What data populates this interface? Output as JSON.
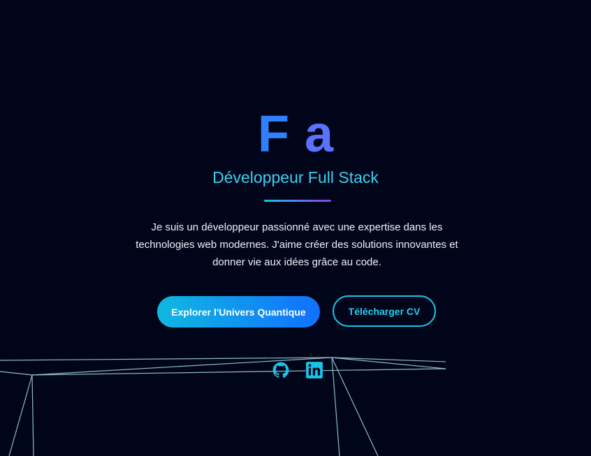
{
  "hero": {
    "name_letter_1": "F",
    "name_letter_2": "a",
    "subtitle": "Développeur Full Stack",
    "description": "Je suis un développeur passionné avec une expertise dans les technologies web modernes. J'aime créer des solutions innovantes et donner vie aux idées grâce au code."
  },
  "buttons": {
    "primary_label": "Explorer l'Univers Quantique",
    "secondary_label": "Télécharger CV"
  },
  "social": [
    {
      "icon": "github-icon"
    },
    {
      "icon": "linkedin-icon"
    }
  ],
  "colors": {
    "background": "#01051a",
    "accent_cyan": "#18c4e6",
    "accent_blue": "#2f80ff",
    "accent_purple": "#8a3ff0",
    "wireframe": "#9ed6e0"
  }
}
